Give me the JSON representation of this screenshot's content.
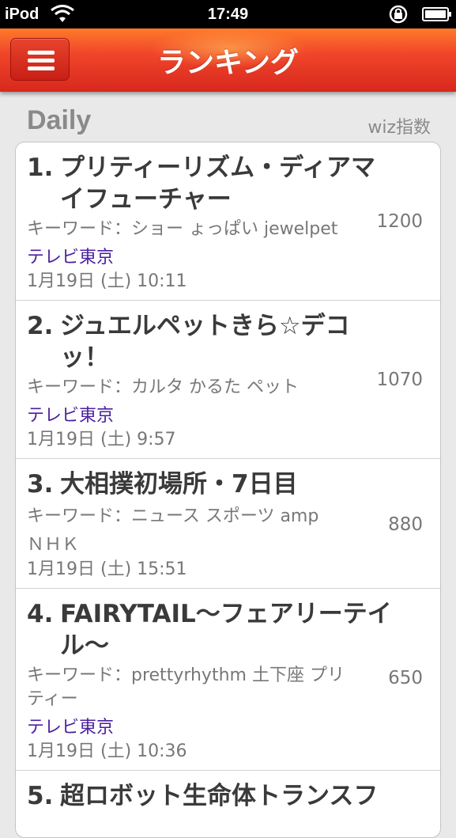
{
  "status_bar": {
    "carrier": "iPod",
    "time": "17:49"
  },
  "nav": {
    "title": "ランキング"
  },
  "section": {
    "title": "Daily",
    "aux_label": "wiz指数"
  },
  "items": [
    {
      "rank": "1.",
      "title_line1": "プリティーリズム・ディアマ",
      "title_line2": "イフューチャー",
      "keywords": "キーワード：ショー ょっぱい jewelpet",
      "channel": "テレビ東京",
      "date": "1月19日 (土) 10:11",
      "score": "1200"
    },
    {
      "rank": "2.",
      "title_line1": "ジュエルペットきら☆デコ",
      "title_line2": "ッ！",
      "keywords": "キーワード：カルタ かるた ペット",
      "channel": "テレビ東京",
      "date": "1月19日 (土) 9:57",
      "score": "1070"
    },
    {
      "rank": "3.",
      "title_line1": "大相撲初場所・7日目",
      "title_line2": "",
      "keywords": "キーワード：ニュース スポーツ amp",
      "channel": "ＮＨＫ",
      "date": "1月19日 (土) 15:51",
      "score": "880"
    },
    {
      "rank": "4.",
      "title_line1": "FAIRYTAIL〜フェアリーテイ",
      "title_line2": "ル〜",
      "keywords": "キーワード：prettyrhythm 土下座 プリティー",
      "channel": "テレビ東京",
      "date": "1月19日 (土) 10:36",
      "score": "650"
    },
    {
      "rank": "5.",
      "title_line1": "超ロボット生命体トランスフ",
      "title_line2": "",
      "keywords": "",
      "channel": "",
      "date": "",
      "score": ""
    }
  ]
}
